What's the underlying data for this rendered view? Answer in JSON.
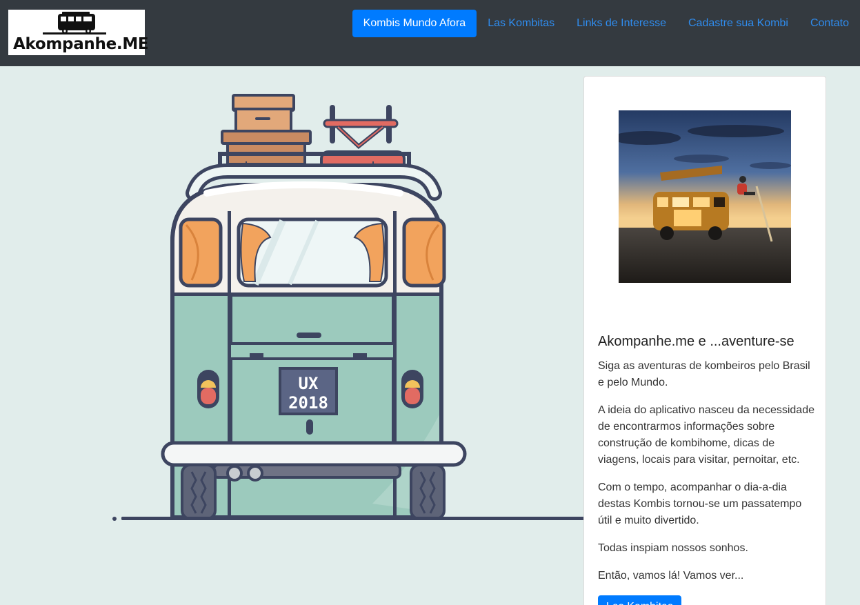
{
  "brand": {
    "logo_text": "Akompanhe.ME",
    "icon": "van-icon"
  },
  "nav": {
    "items": [
      {
        "label": "Kombis Mundo Afora",
        "active": true
      },
      {
        "label": "Las Kombitas",
        "active": false
      },
      {
        "label": "Links de Interesse",
        "active": false
      },
      {
        "label": "Cadastre sua Kombi",
        "active": false
      },
      {
        "label": "Contato",
        "active": false
      }
    ]
  },
  "hero": {
    "plate_line1": "UX",
    "plate_line2": "2018"
  },
  "card": {
    "title": "Akompanhe.me e ...aventure-se",
    "paragraphs": [
      "Siga as aventuras de kombeiros pelo Brasil e pelo Mundo.",
      "A ideia do aplicativo nasceu da necessidade de encontrarmos informações sobre construção de kombihome, dicas de viagens, locais para visitar, pernoitar, etc.",
      "Com o tempo, acompanhar o dia-a-dia destas Kombis tornou-se um passatempo útil e muito divertido.",
      "Todas inspiam nossos sonhos.",
      "Então, vamos lá! Vamos ver..."
    ],
    "button_label": "Las Kombitas"
  },
  "colors": {
    "navbar_bg": "#343a40",
    "accent": "#007bff",
    "link": "#2f8df0",
    "page_bg": "#e1edeb",
    "van_body": "#9ccabd"
  }
}
